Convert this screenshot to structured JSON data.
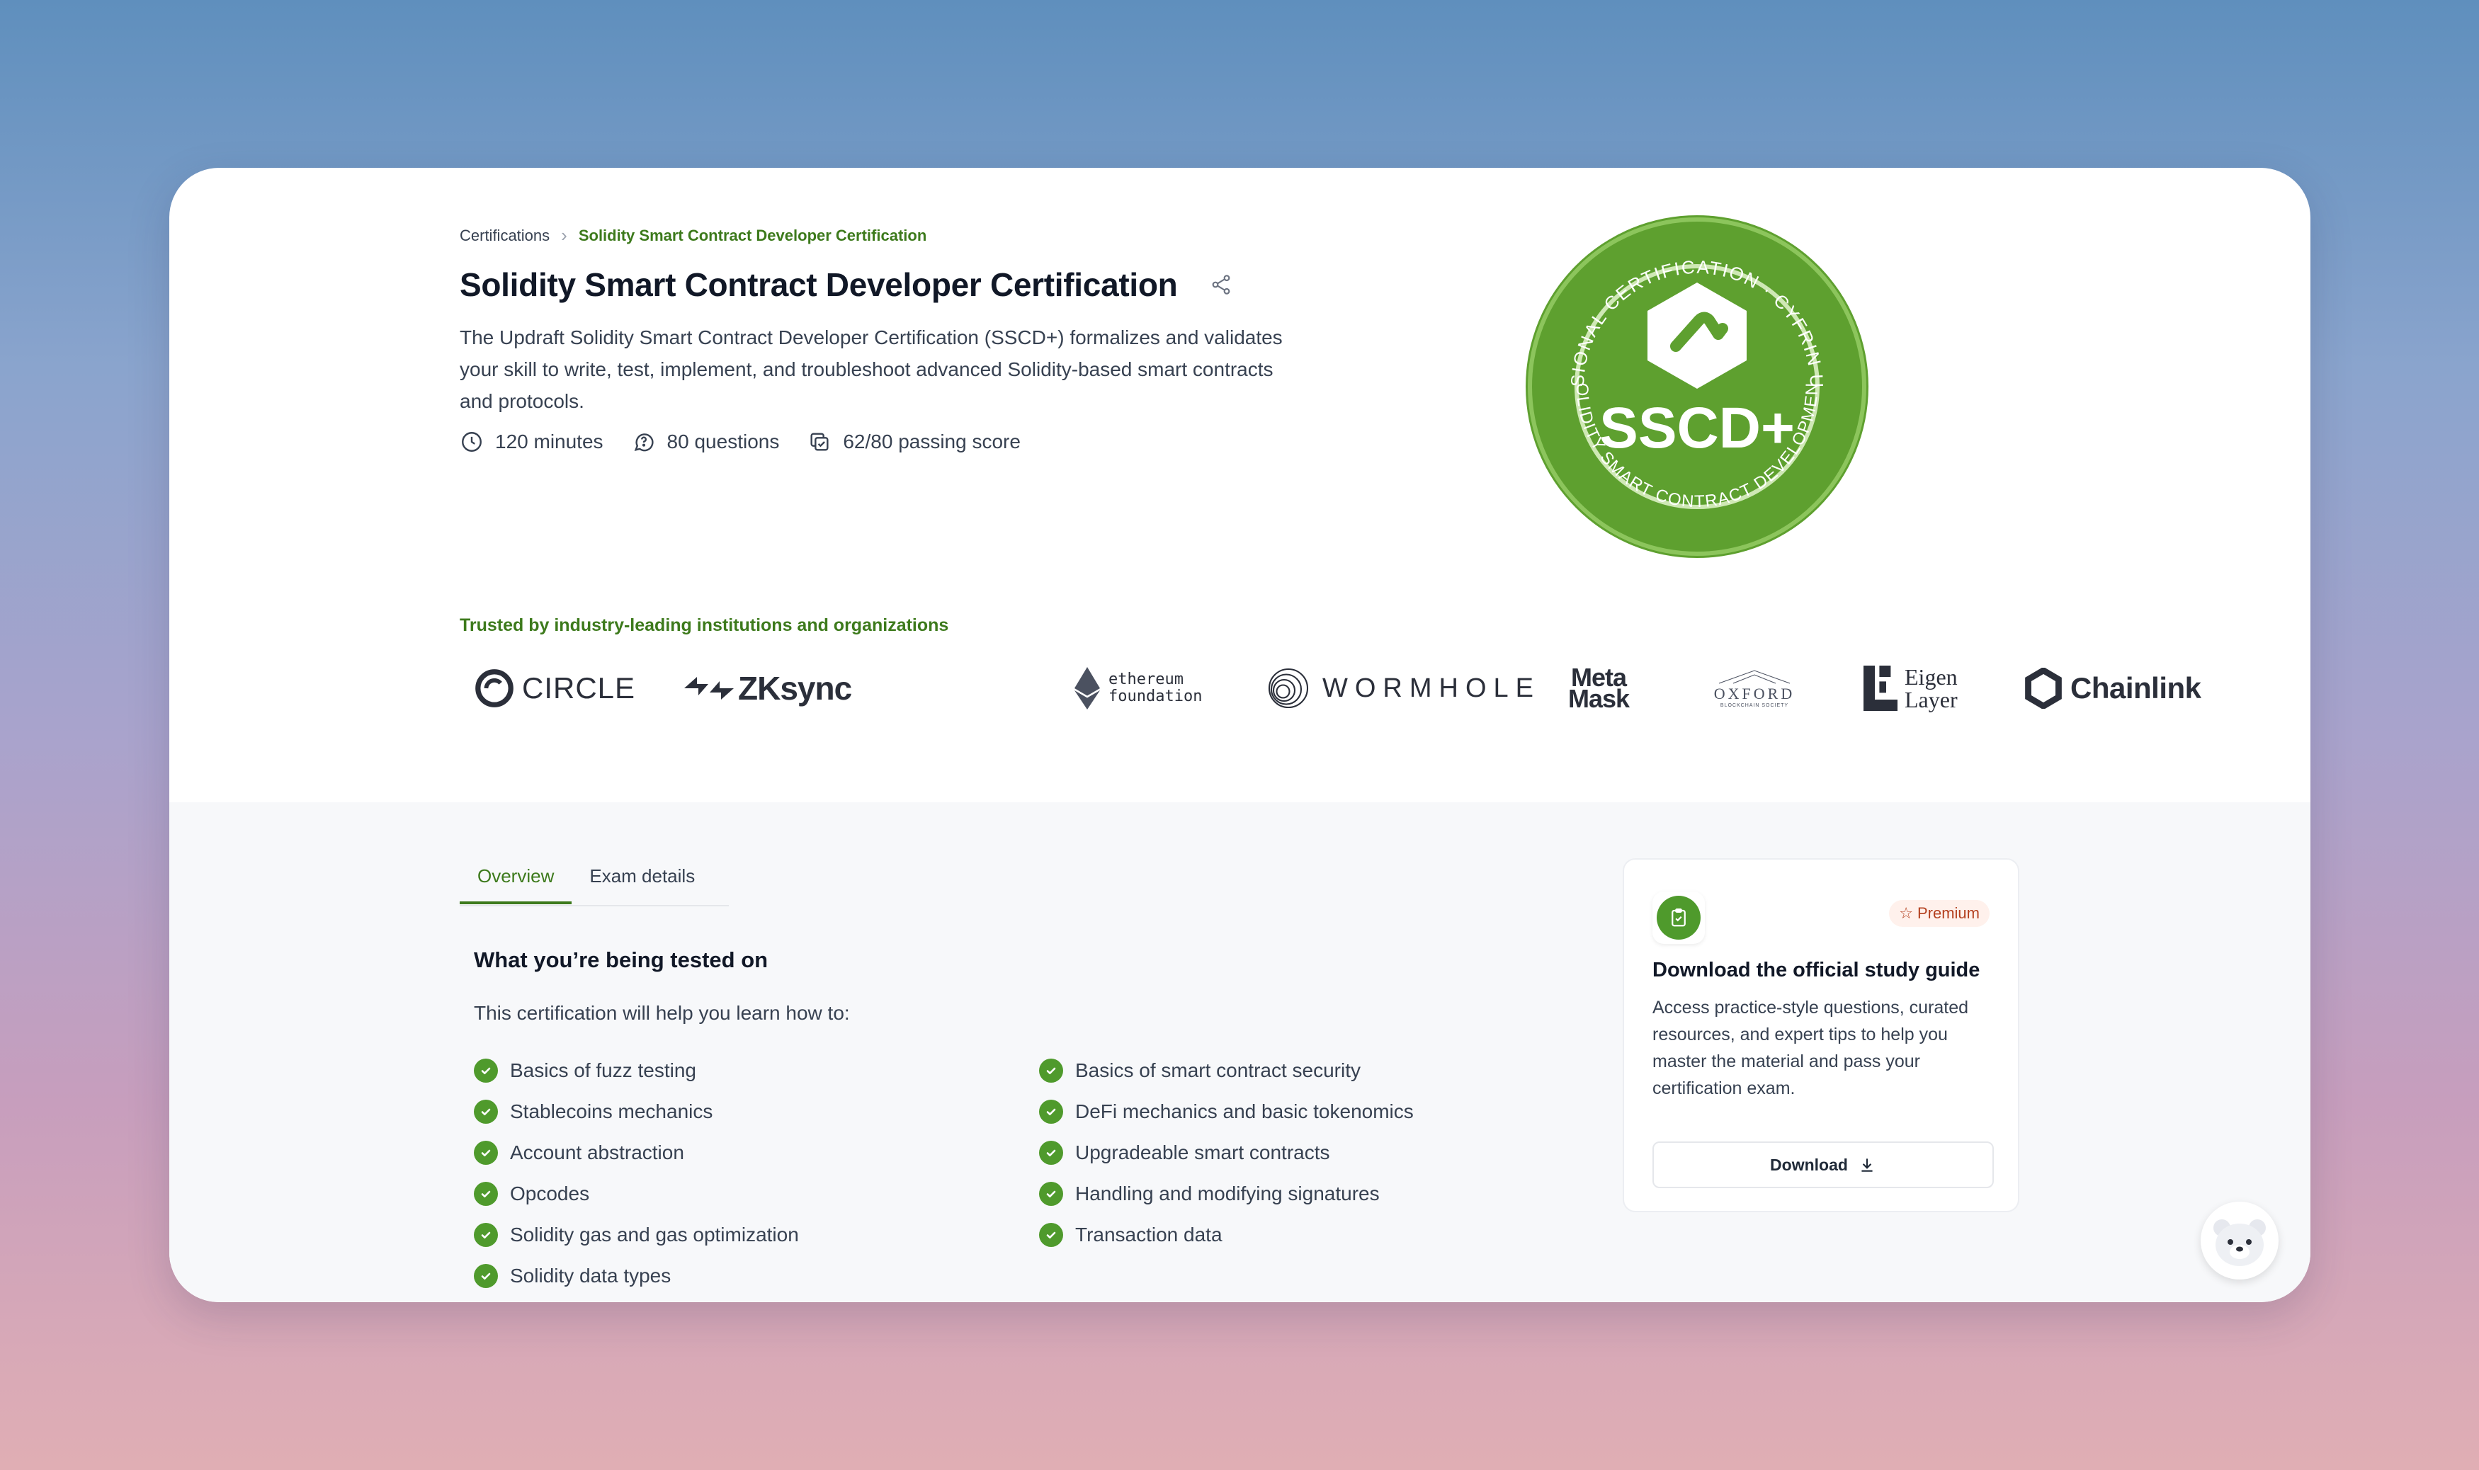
{
  "breadcrumb": {
    "items": [
      "Certifications",
      "Solidity Smart Contract Developer Certification"
    ]
  },
  "header": {
    "title": "Solidity Smart Contract Developer Certification",
    "description": "The Updraft Solidity Smart Contract Developer Certification (SSCD+) formalizes and validates your skill to write, test, implement, and troubleshoot advanced Solidity-based smart contracts and protocols.",
    "meta": {
      "duration": "120 minutes",
      "questions": "80 questions",
      "passing": "62/80 passing score"
    }
  },
  "badge": {
    "label": "SSCD+",
    "ring_top": "PROFESSIONAL CERTIFICATION · CYFRIN UPDRAFT",
    "ring_bottom": "SOLIDITY SMART CONTRACT DEVELOPMENT",
    "color": "#5ea02f"
  },
  "trusted": {
    "heading": "Trusted by industry-leading institutions and organizations",
    "logos": {
      "circle": "CIRCLE",
      "zksync": "ZKsync",
      "ethereum_1": "ethereum",
      "ethereum_2": "foundation",
      "wormhole": "WORMHOLE",
      "metamask_1": "Meta",
      "metamask_2": "Mask",
      "oxford": "OXFORD",
      "oxford_sub": "BLOCKCHAIN SOCIETY",
      "eigen_1": "Eigen",
      "eigen_2": "Layer",
      "chainlink": "Chainlink"
    }
  },
  "tabs": [
    {
      "label": "Overview"
    },
    {
      "label": "Exam details"
    }
  ],
  "tested": {
    "heading": "What you’re being tested on",
    "intro": "This certification will help you learn how to:",
    "left": [
      "Basics of fuzz testing",
      "Stablecoins mechanics",
      "Account abstraction",
      "Opcodes",
      "Solidity gas and gas optimization",
      "Solidity data types"
    ],
    "right": [
      "Basics of smart contract security",
      "DeFi mechanics and basic tokenomics",
      "Upgradeable smart contracts",
      "Handling and modifying signatures",
      "Transaction data"
    ]
  },
  "guide": {
    "badge": "Premium",
    "title": "Download the official study guide",
    "description": "Access practice-style questions, curated resources, and expert tips to help you master the material and pass your certification exam.",
    "button": "Download"
  },
  "colors": {
    "accent_green": "#3d7a1c",
    "check_green": "#4f9a2c",
    "premium_text": "#b4401f"
  },
  "icons": [
    "chevron-right-icon",
    "share-icon",
    "clock-icon",
    "chat-question-icon",
    "copy-check-icon",
    "check-circle-icon",
    "clipboard-check-icon",
    "star-icon",
    "download-icon",
    "bear-mascot-icon"
  ]
}
